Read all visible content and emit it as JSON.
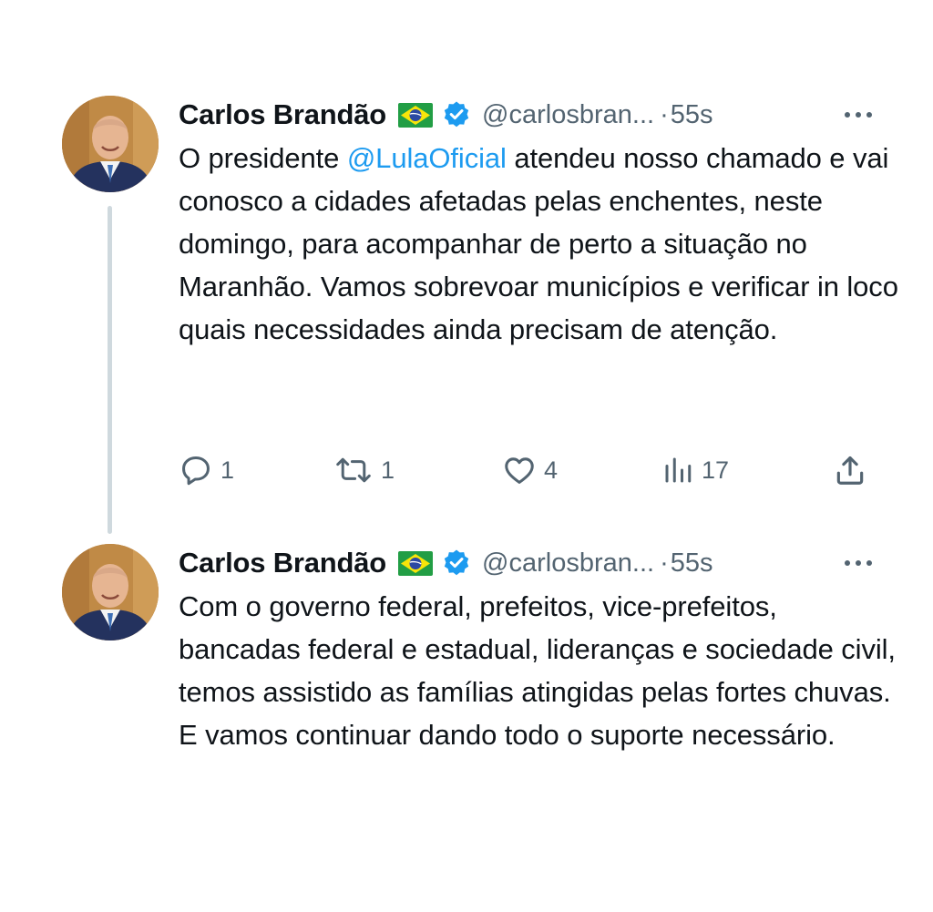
{
  "tweets": [
    {
      "author_name": "Carlos Brandão",
      "flag_icon": "brazil-flag-icon",
      "verified_icon": "verified-badge-icon",
      "handle": "@carlosbran...",
      "separator": "·",
      "time": "55s",
      "text_before_mention": "O presidente ",
      "mention": "@LulaOficial",
      "text_after_mention": " atendeu nosso chamado e vai conosco a cidades afetadas pelas enchentes, neste domingo, para acompanhar de perto a situação no Maranhão. Vamos sobrevoar municípios e verificar in loco quais necessidades ainda precisam de atenção.",
      "stats": {
        "replies": "1",
        "reposts": "1",
        "likes": "4",
        "views": "17"
      }
    },
    {
      "author_name": "Carlos Brandão",
      "flag_icon": "brazil-flag-icon",
      "verified_icon": "verified-badge-icon",
      "handle": "@carlosbran...",
      "separator": "·",
      "time": "55s",
      "text": "Com o governo federal, prefeitos, vice-prefeitos, bancadas federal e estadual, lideranças e sociedade civil, temos assistido as famílias atingidas pelas fortes chuvas. E vamos continuar dando todo o suporte necessário."
    }
  ],
  "colors": {
    "text": "#0f1419",
    "secondary": "#536471",
    "link": "#1d9bf0",
    "verified": "#1d9bf0",
    "thread_line": "#cfd9de"
  }
}
